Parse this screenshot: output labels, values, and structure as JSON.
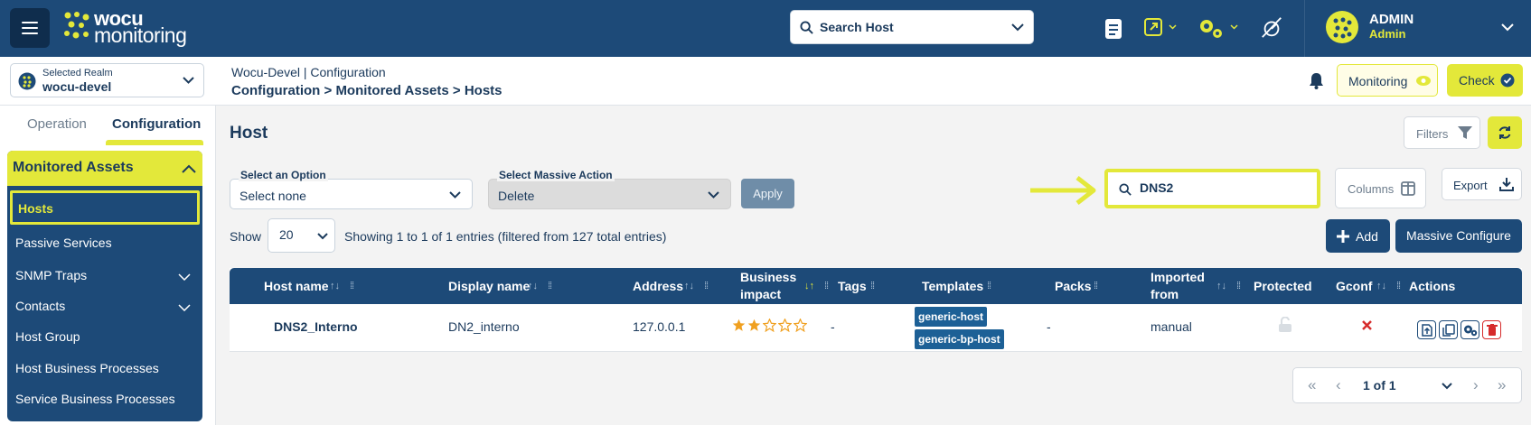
{
  "topbar": {
    "logo_line1": "wocu",
    "logo_line2": "monitoring",
    "search_host_label": "Search Host",
    "user_name": "ADMIN",
    "user_role": "Admin"
  },
  "subbar": {
    "realm_label": "Selected Realm",
    "realm_value": "wocu-devel",
    "crumb_top": "Wocu-Devel | Configuration",
    "crumb_1": "Configuration",
    "crumb_2": "Monitored Assets",
    "crumb_3": "Hosts",
    "sep": ">",
    "monitoring_label": "Monitoring",
    "check_label": "Check"
  },
  "sidebar": {
    "tab_operation": "Operation",
    "tab_configuration": "Configuration",
    "group_title": "Monitored Assets",
    "items": [
      {
        "label": "Hosts"
      },
      {
        "label": "Passive Services"
      },
      {
        "label": "SNMP Traps"
      },
      {
        "label": "Contacts"
      },
      {
        "label": "Host Group"
      },
      {
        "label": "Host Business Processes"
      },
      {
        "label": "Service Business Processes"
      }
    ]
  },
  "main": {
    "title": "Host",
    "filters_label": "Filters",
    "select_option_label": "Select an Option",
    "select_option_value": "Select none",
    "massive_action_label": "Select Massive Action",
    "massive_action_value": "Delete",
    "apply_label": "Apply",
    "search_value": "DNS2",
    "columns_label": "Columns",
    "export_label": "Export",
    "show_label": "Show",
    "page_size": "20",
    "entries_info": "Showing 1 to 1 of 1 entries (filtered from 127 total entries)",
    "add_label": "Add",
    "massive_configure_label": "Massive Configure"
  },
  "table": {
    "headers": {
      "host_name": "Host name",
      "display_name": "Display name",
      "address": "Address",
      "business_impact_1": "Business",
      "business_impact_2": "impact",
      "tags": "Tags",
      "templates": "Templates",
      "packs": "Packs",
      "imported_from_1": "Imported",
      "imported_from_2": "from",
      "protected": "Protected",
      "gconf": "Gconf",
      "actions": "Actions"
    },
    "rows": [
      {
        "host_name": "DNS2_Interno",
        "display_name": "DN2_interno",
        "address": "127.0.0.1",
        "business_impact_stars": 2,
        "business_impact_max": 5,
        "tags": "-",
        "templates": [
          "generic-host",
          "generic-bp-host"
        ],
        "packs": "-",
        "imported_from": "manual",
        "protected_icon": "unlock-icon",
        "gconf_icon": "cross-icon"
      }
    ]
  },
  "pager": {
    "page_text": "1 of 1"
  },
  "colors": {
    "brand_blue": "#1d4a78",
    "accent_yellow": "#e3e83a",
    "star": "#f0a020",
    "delete_red": "#d62b2b"
  }
}
